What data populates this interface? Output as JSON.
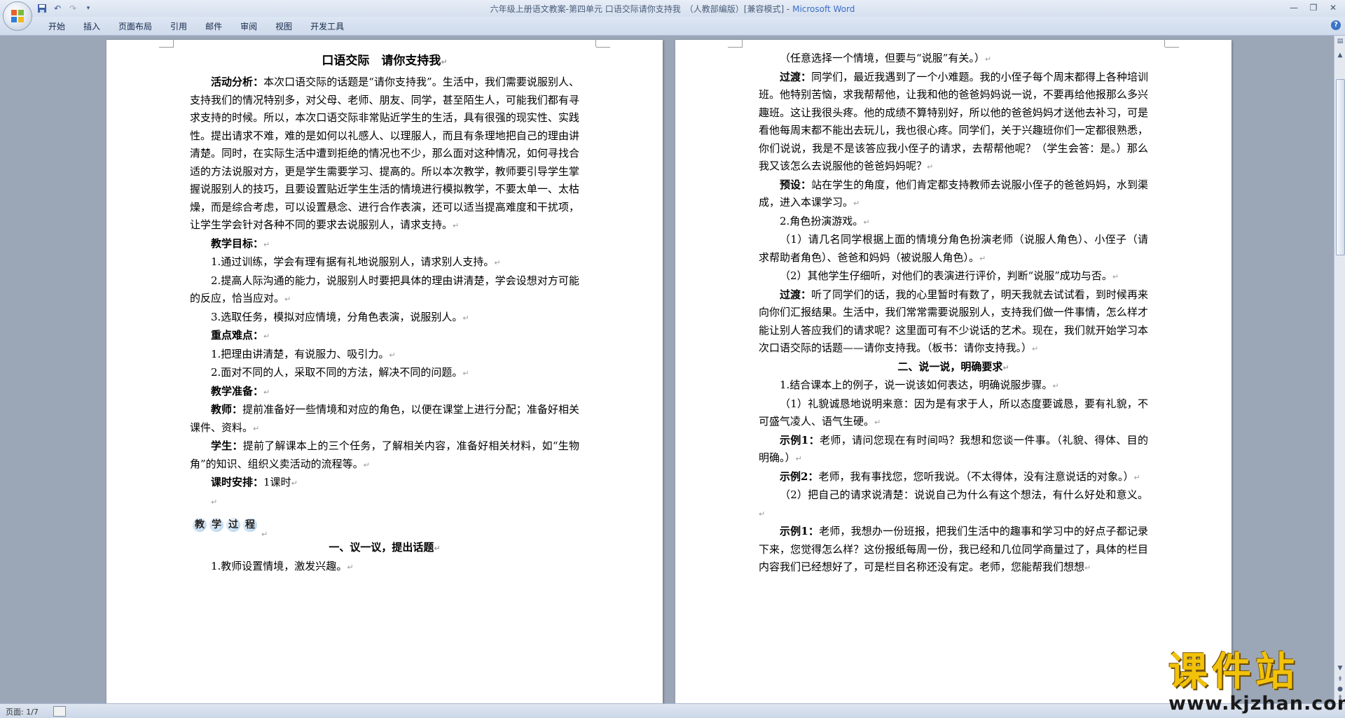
{
  "window": {
    "title": "六年级上册语文教案-第四单元 口语交际请你支持我　（人教部编版）[兼容模式] - ",
    "app_name": "Microsoft Word"
  },
  "ribbon": {
    "tabs": [
      "开始",
      "插入",
      "页面布局",
      "引用",
      "邮件",
      "审阅",
      "视图",
      "开发工具"
    ]
  },
  "status": {
    "page": "页面: 1/7"
  },
  "watermark": {
    "title": "课件站",
    "url": "www.kjzhan.com"
  },
  "page1": {
    "title": "口语交际　请你支持我",
    "paragraphs": [
      {
        "label": "活动分析：",
        "text": "本次口语交际的话题是“请你支持我”。生活中，我们需要说服别人、支持我们的情况特别多，对父母、老师、朋友、同学，甚至陌生人，可能我们都有寻求支持的时候。所以，本次口语交际非常贴近学生的生活，具有很强的现实性、实践性。提出请求不难，难的是如何以礼感人、以理服人，而且有条理地把自己的理由讲清楚。同时，在实际生活中遭到拒绝的情况也不少，那么面对这种情况，如何寻找合适的方法说服对方，更是学生需要学习、提高的。所以本次教学，教师要引导学生掌握说服别人的技巧，且要设置贴近学生生活的情境进行模拟教学，不要太单一、太枯燥，而是综合考虑，可以设置悬念、进行合作表演，还可以适当提高难度和干扰项，让学生学会针对各种不同的要求去说服别人，请求支持。"
      },
      {
        "label": "教学目标：",
        "text": ""
      },
      {
        "label": "",
        "text": "1.通过训练，学会有理有据有礼地说服别人，请求别人支持。"
      },
      {
        "label": "",
        "text": "2.提高人际沟通的能力，说服别人时要把具体的理由讲清楚，学会设想对方可能的反应，恰当应对。"
      },
      {
        "label": "",
        "text": "3.选取任务，模拟对应情境，分角色表演，说服别人。"
      },
      {
        "label": "重点难点：",
        "text": ""
      },
      {
        "label": "",
        "text": "1.把理由讲清楚，有说服力、吸引力。"
      },
      {
        "label": "",
        "text": "2.面对不同的人，采取不同的方法，解决不同的问题。"
      },
      {
        "label": "教学准备：",
        "text": ""
      },
      {
        "label": "教师：",
        "text": "提前准备好一些情境和对应的角色，以便在课堂上进行分配；准备好相关课件、资料。"
      },
      {
        "label": "学生：",
        "text": "提前了解课本上的三个任务，了解相关内容，准备好相关材料，如“生物角”的知识、组织义卖活动的流程等。"
      },
      {
        "label": "课时安排：",
        "text": "1课时"
      }
    ],
    "process_badge": [
      "教",
      "学",
      "过",
      "程"
    ],
    "section1_heading": "一、议一议，提出话题",
    "last_line": "1.教师设置情境，激发兴趣。"
  },
  "page2": {
    "paragraphs": [
      {
        "label": "",
        "text": "（任意选择一个情境，但要与“说服”有关。）"
      },
      {
        "label": "过渡：",
        "text": "同学们，最近我遇到了一个小难题。我的小侄子每个周末都得上各种培训班。他特别苦恼，求我帮帮他，让我和他的爸爸妈妈说一说，不要再给他报那么多兴趣班。这让我很头疼。他的成绩不算特别好，所以他的爸爸妈妈才送他去补习，可是看他每周末都不能出去玩儿，我也很心疼。同学们，关于兴趣班你们一定都很熟悉，你们说说，我是不是该答应我小侄子的请求，去帮帮他呢？（学生会答：是。）那么我又该怎么去说服他的爸爸妈妈呢？"
      },
      {
        "label": "预设：",
        "text": "站在学生的角度，他们肯定都支持教师去说服小侄子的爸爸妈妈，水到渠成，进入本课学习。"
      },
      {
        "label": "",
        "text": "2.角色扮演游戏。"
      },
      {
        "label": "",
        "text": "（1）请几名同学根据上面的情境分角色扮演老师（说服人角色）、小侄子（请求帮助者角色）、爸爸和妈妈（被说服人角色）。"
      },
      {
        "label": "",
        "text": "（2）其他学生仔细听，对他们的表演进行评价，判断“说服”成功与否。"
      },
      {
        "label": "过渡：",
        "text": "听了同学们的话，我的心里暂时有数了，明天我就去试试看，到时候再来向你们汇报结果。生活中，我们常常需要说服别人，支持我们做一件事情，怎么样才能让别人答应我们的请求呢？这里面可有不少说话的艺术。现在，我们就开始学习本次口语交际的话题——请你支持我。（板书：请你支持我。）"
      }
    ],
    "section2_heading": "二、说一说，明确要求",
    "paragraphs2": [
      {
        "label": "",
        "text": "1.结合课本上的例子，说一说该如何表达，明确说服步骤。"
      },
      {
        "label": "",
        "text": "（1）礼貌诚恳地说明来意：因为是有求于人，所以态度要诚恳，要有礼貌，不可盛气凌人、语气生硬。"
      },
      {
        "label": "示例1：",
        "text": "老师，请问您现在有时间吗？我想和您谈一件事。（礼貌、得体、目的明确。）"
      },
      {
        "label": "示例2：",
        "text": "老师，我有事找您，您听我说。（不太得体，没有注意说话的对象。）"
      },
      {
        "label": "",
        "text": "（2）把自己的请求说清楚：说说自己为什么有这个想法，有什么好处和意义。"
      },
      {
        "label": "示例1：",
        "text": "老师，我想办一份班报，把我们生活中的趣事和学习中的好点子都记录下来，您觉得怎么样？这份报纸每周一份，我已经和几位同学商量过了，具体的栏目内容我们已经想好了，可是栏目名称还没有定。老师，您能帮我们想想"
      }
    ]
  }
}
